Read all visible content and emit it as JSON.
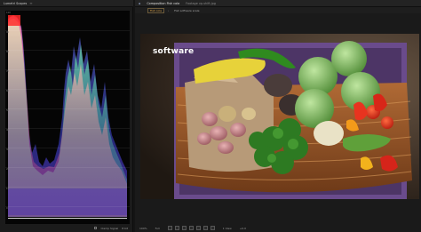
{
  "scopes_panel": {
    "tab_label": "Lumetri Scopes",
    "scale_labels": [
      "100",
      "90",
      "80",
      "70",
      "60",
      "50",
      "40",
      "30",
      "20",
      "10",
      "0"
    ],
    "toolbar": {
      "clamp_signal_label": "Clamp Signal",
      "float_label": "8 bit"
    }
  },
  "composition_panel": {
    "tabs": [
      {
        "label": "Composition  Fish cola",
        "active": true
      },
      {
        "label": "Footage  vp-shift.jpg",
        "active": false
      }
    ],
    "subtabs": [
      {
        "label": "Fish cola",
        "active": true
      },
      {
        "label": "Fish software scale",
        "active": false
      }
    ],
    "watermark_text": "software",
    "bottom_bar": {
      "zoom": "100%",
      "resolution": "Full",
      "camera": "1 View",
      "exposure": "+0.0"
    }
  },
  "colors": {
    "panel_bg": "#1b1b1b",
    "scope_bg": "#050505",
    "accent": "#e2a546"
  }
}
